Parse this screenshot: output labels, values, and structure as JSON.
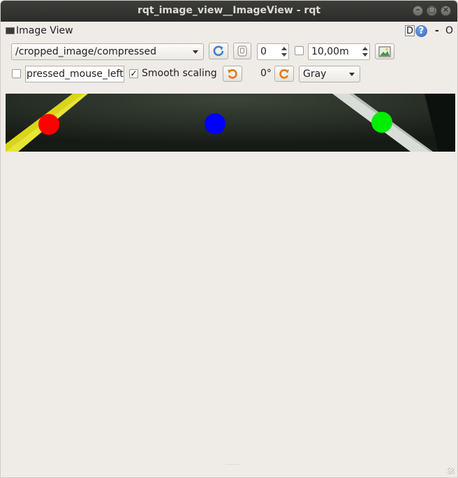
{
  "window": {
    "title": "rqt_image_view__ImageView - rqt"
  },
  "plugin": {
    "title": "Image View",
    "help_d": "D",
    "help_q": "?",
    "dash": "-",
    "close": "O"
  },
  "toolbar": {
    "topic": "/cropped_image/compressed",
    "frame_value": "0",
    "rate_value": "10,00m",
    "mouse_topic": "pressed_mouse_left",
    "smooth_label": "Smooth scaling",
    "smooth_checked": "✓",
    "rotation": "0°",
    "color_scheme": "Gray"
  },
  "image": {
    "dots": [
      {
        "name": "red-dot",
        "color": "#ff0000"
      },
      {
        "name": "blue-dot",
        "color": "#0000ff"
      },
      {
        "name": "green-dot",
        "color": "#00ee00"
      }
    ]
  },
  "status": {
    "grip": "......"
  }
}
